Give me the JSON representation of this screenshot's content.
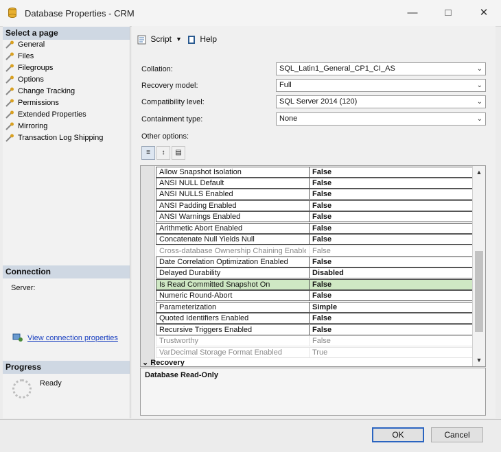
{
  "window": {
    "title": "Database Properties - CRM"
  },
  "select_page": {
    "header": "Select a page",
    "items": [
      "General",
      "Files",
      "Filegroups",
      "Options",
      "Change Tracking",
      "Permissions",
      "Extended Properties",
      "Mirroring",
      "Transaction Log Shipping"
    ]
  },
  "connection": {
    "header": "Connection",
    "server_label": "Server:",
    "link": "View connection properties"
  },
  "progress": {
    "header": "Progress",
    "status": "Ready"
  },
  "toolbar": {
    "script_label": "Script",
    "help_label": "Help"
  },
  "form": {
    "collation": {
      "label": "Collation:",
      "value": "SQL_Latin1_General_CP1_CI_AS"
    },
    "recovery_model": {
      "label": "Recovery model:",
      "value": "Full"
    },
    "compat_level": {
      "label": "Compatibility level:",
      "value": "SQL Server 2014 (120)"
    },
    "containment": {
      "label": "Containment type:",
      "value": "None"
    },
    "other_options": "Other options:"
  },
  "grid": {
    "rows": [
      {
        "name": "Allow Snapshot Isolation",
        "value": "False"
      },
      {
        "name": "ANSI NULL Default",
        "value": "False"
      },
      {
        "name": "ANSI NULLS Enabled",
        "value": "False"
      },
      {
        "name": "ANSI Padding Enabled",
        "value": "False"
      },
      {
        "name": "ANSI Warnings Enabled",
        "value": "False"
      },
      {
        "name": "Arithmetic Abort Enabled",
        "value": "False"
      },
      {
        "name": "Concatenate Null Yields Null",
        "value": "False"
      },
      {
        "name": "Cross-database Ownership Chaining Enabled",
        "value": "False"
      },
      {
        "name": "Date Correlation Optimization Enabled",
        "value": "False"
      },
      {
        "name": "Delayed Durability",
        "value": "Disabled"
      },
      {
        "name": "Is Read Committed Snapshot On",
        "value": "False"
      },
      {
        "name": "Numeric Round-Abort",
        "value": "False"
      },
      {
        "name": "Parameterization",
        "value": "Simple"
      },
      {
        "name": "Quoted Identifiers Enabled",
        "value": "False"
      },
      {
        "name": "Recursive Triggers Enabled",
        "value": "False"
      },
      {
        "name": "Trustworthy",
        "value": "False"
      },
      {
        "name": "VarDecimal Storage Format Enabled",
        "value": "True"
      }
    ],
    "category_recovery": "Recovery"
  },
  "description": {
    "title": "Database Read-Only"
  },
  "buttons": {
    "ok": "OK",
    "cancel": "Cancel"
  }
}
